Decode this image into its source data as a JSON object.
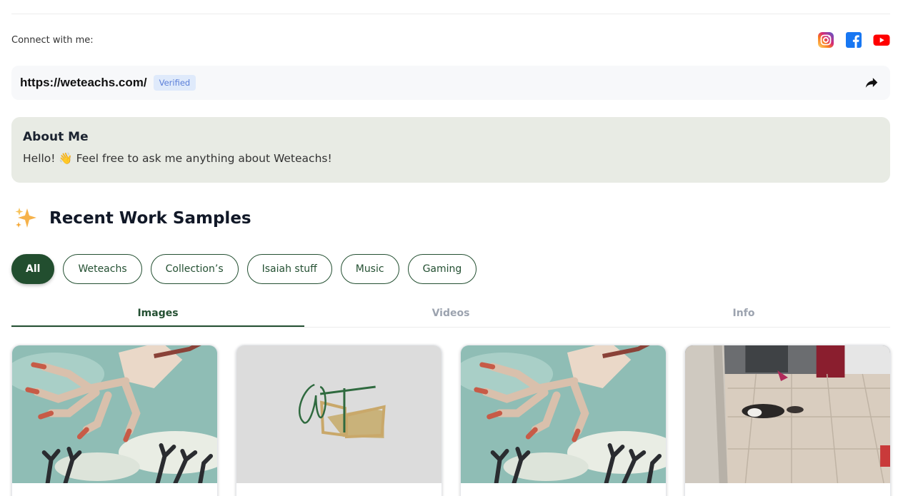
{
  "connect": {
    "label": "Connect with me:",
    "socials": [
      {
        "icon": "instagram-icon",
        "color": "#d62976"
      },
      {
        "icon": "facebook-icon",
        "color": "#1877f2"
      },
      {
        "icon": "youtube-icon",
        "color": "#ff0000"
      }
    ]
  },
  "profile_link": {
    "url": "https://weteachs.com/",
    "badge": "Verified",
    "share_icon": "share-icon"
  },
  "about": {
    "title": "About Me",
    "text": "Hello! 👋 Feel free to ask me anything about Weteachs!",
    "background": "#e8ebe4"
  },
  "samples": {
    "title": "Recent Work Samples",
    "icon": "sparkles-icon",
    "filters": [
      {
        "label": "All",
        "active": true
      },
      {
        "label": "Weteachs",
        "active": false
      },
      {
        "label": "Collection’s",
        "active": false
      },
      {
        "label": "Isaiah stuff",
        "active": false
      },
      {
        "label": "Music",
        "active": false
      },
      {
        "label": "Gaming",
        "active": false
      }
    ],
    "tabs": [
      {
        "label": "Images",
        "active": true
      },
      {
        "label": "Videos",
        "active": false
      },
      {
        "label": "Info",
        "active": false
      }
    ],
    "cards": [
      {
        "image": "robot-hand-art"
      },
      {
        "image": "weteachs-logo",
        "logo_text": "WT"
      },
      {
        "image": "robot-hand-art"
      },
      {
        "image": "dogs-on-tile-floor-photo"
      }
    ]
  },
  "colors": {
    "accent": "#245032",
    "verified_bg": "#dfeafb",
    "verified_text": "#5a7ed8",
    "card_bg": "#f7f8fa"
  }
}
